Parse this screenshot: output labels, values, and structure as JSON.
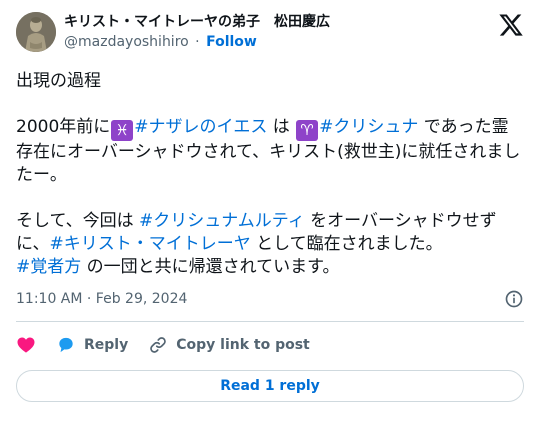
{
  "author": {
    "display_name": "キリスト・マイトレーヤの弟子　松田慶広",
    "handle": "@mazdayoshihiro",
    "separator": "·",
    "follow_label": "Follow"
  },
  "tweet": {
    "line1": "出現の過程",
    "p2_a": "2000年前に",
    "p2_emoji1": "♓",
    "p2_tag1": "#ナザレのイエス",
    "p2_b": " は",
    "p2_emoji2": "♈",
    "p2_tag2": "#クリシュナ",
    "p2_c": " であった霊存在にオーバーシャドウされて、キリスト(救世主)に就任されましたー。",
    "p3_a": "そして、今回は ",
    "p3_tag1": "#クリシュナムルティ",
    "p3_b": " をオーバーシャドウせずに、",
    "p3_tag2": "#キリスト・マイトレーヤ",
    "p3_c": " として臨在されました。",
    "p4_tag": "#覚者方",
    "p4_a": " の一団と共に帰還されています。"
  },
  "meta": {
    "timestamp": "11:10 AM · Feb 29, 2024"
  },
  "actions": {
    "reply_label": "Reply",
    "copy_label": "Copy link to post",
    "read_replies_label": "Read 1 reply"
  },
  "colors": {
    "link": "#006fd6",
    "like": "#f91880",
    "reply": "#1d9bf0",
    "emoji_bg": "#8e43c9"
  },
  "icons": [
    "x-logo-icon",
    "info-icon",
    "heart-icon",
    "reply-bubble-icon",
    "link-icon"
  ]
}
